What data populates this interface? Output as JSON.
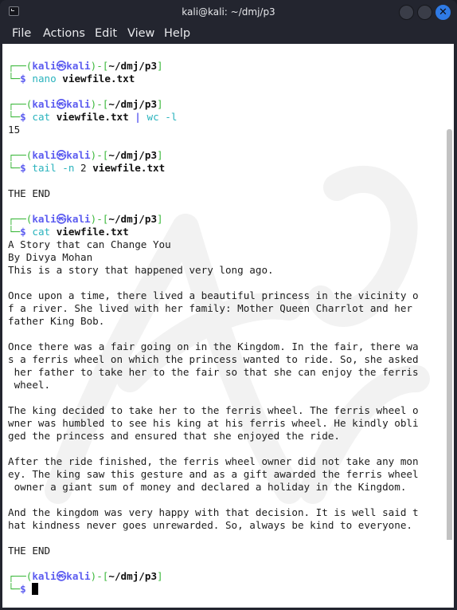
{
  "window": {
    "title": "kali@kali: ~/dmj/p3",
    "controls": [
      {
        "name": "minimize",
        "icon": "circle"
      },
      {
        "name": "maximize",
        "icon": "circle"
      },
      {
        "name": "close",
        "icon": "✕",
        "color": "#2f7ae5"
      }
    ]
  },
  "menu": [
    "File",
    "Actions",
    "Edit",
    "View",
    "Help"
  ],
  "prompt": {
    "top_left": "┌──",
    "bottom_left": "└─",
    "user": "kali",
    "at_symbol": "㉿",
    "host": "kali",
    "cwd": "~/dmj/p3",
    "symbol": "$"
  },
  "session": [
    {
      "type": "prompt",
      "cmd": "nano",
      "args": "viewfile.txt"
    },
    {
      "type": "blank"
    },
    {
      "type": "prompt",
      "cmd": "cat",
      "args": "viewfile.txt",
      "pipe": "|",
      "cmd2": "wc -l"
    },
    {
      "type": "output",
      "text": "15"
    },
    {
      "type": "blank"
    },
    {
      "type": "prompt",
      "cmd": "tail -n",
      "num": "2",
      "args": "viewfile.txt"
    },
    {
      "type": "blank"
    },
    {
      "type": "output",
      "text": "THE END"
    },
    {
      "type": "blank"
    },
    {
      "type": "prompt",
      "cmd": "cat",
      "args": "viewfile.txt"
    },
    {
      "type": "output",
      "text": "A Story that can Change You"
    },
    {
      "type": "output",
      "text": "By Divya Mohan"
    },
    {
      "type": "output",
      "text": "This is a story that happened very long ago."
    },
    {
      "type": "blank"
    },
    {
      "type": "output",
      "text": "Once upon a time, there lived a beautiful princess in the vicinity o"
    },
    {
      "type": "output",
      "text": "f a river. She lived with her family: Mother Queen Charrlot and her"
    },
    {
      "type": "output",
      "text": "father King Bob."
    },
    {
      "type": "blank"
    },
    {
      "type": "output",
      "text": "Once there was a fair going on in the Kingdom. In the fair, there wa"
    },
    {
      "type": "output",
      "text": "s a ferris wheel on which the princess wanted to ride. So, she asked"
    },
    {
      "type": "output",
      "text": " her father to take her to the fair so that she can enjoy the ferris"
    },
    {
      "type": "output",
      "text": " wheel."
    },
    {
      "type": "blank"
    },
    {
      "type": "output",
      "text": "The king decided to take her to the ferris wheel. The ferris wheel o"
    },
    {
      "type": "output",
      "text": "wner was humbled to see his king at his ferris wheel. He kindly obli"
    },
    {
      "type": "output",
      "text": "ged the princess and ensured that she enjoyed the ride."
    },
    {
      "type": "blank"
    },
    {
      "type": "output",
      "text": "After the ride finished, the ferris wheel owner did not take any mon"
    },
    {
      "type": "output",
      "text": "ey. The king saw this gesture and as a gift awarded the ferris wheel"
    },
    {
      "type": "output",
      "text": " owner a giant sum of money and declared a holiday in the Kingdom."
    },
    {
      "type": "blank"
    },
    {
      "type": "output",
      "text": "And the kingdom was very happy with that decision. It is well said t"
    },
    {
      "type": "output",
      "text": "hat kindness never goes unrewarded. So, always be kind to everyone."
    },
    {
      "type": "blank"
    },
    {
      "type": "output",
      "text": "THE END"
    },
    {
      "type": "blank"
    },
    {
      "type": "prompt",
      "cmd": "",
      "args": "",
      "cursor": true
    }
  ],
  "colors": {
    "prompt_frame": "#3cb83c",
    "prompt_user": "#5c5cf0",
    "command": "#2ab3bd",
    "background": "#ffffff",
    "chrome": "#23252f"
  }
}
